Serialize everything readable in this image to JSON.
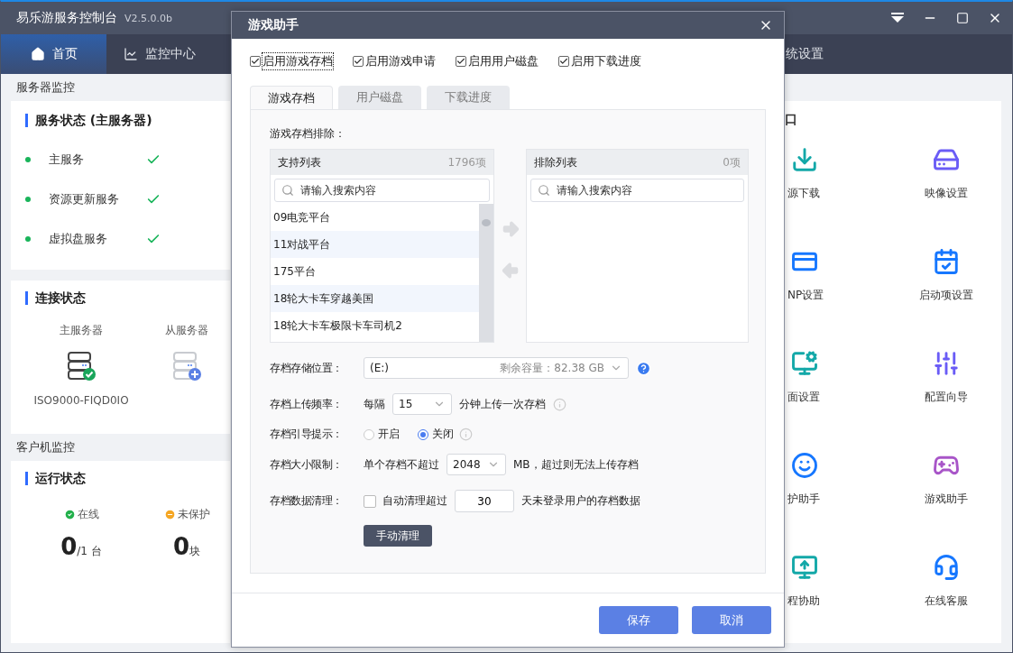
{
  "app": {
    "title": "易乐游服务控制台",
    "version": "V2.5.0.0b"
  },
  "nav": [
    {
      "label": "首页",
      "selected": true
    },
    {
      "label": "监控中心",
      "selected": false
    },
    {
      "label": "统设置",
      "selected": false
    }
  ],
  "server_monitor": {
    "heading": "服务器监控",
    "service_status": {
      "title": "服务状态 (主服务器)",
      "services": [
        {
          "name": "主服务",
          "ok": true
        },
        {
          "name": "资源更新服务",
          "ok": true
        },
        {
          "name": "虚拟盘服务",
          "ok": true
        }
      ]
    },
    "connection": {
      "title": "连接状态",
      "servers": [
        {
          "label": "主服务器",
          "name": "ISO9000-FIQD0IO",
          "connected": true
        },
        {
          "label": "从服务器",
          "connected": false
        }
      ]
    }
  },
  "client_monitor": {
    "heading": "客户机监控",
    "title": "运行状态",
    "stats": [
      {
        "kind": "online",
        "label": "在线",
        "value": "0",
        "unit": "/1 台"
      },
      {
        "kind": "unprotected",
        "label": "未保护",
        "value": "0",
        "unit": "块"
      }
    ]
  },
  "entries": {
    "title": "口",
    "items": [
      {
        "label": "源下载"
      },
      {
        "label": "映像设置"
      },
      {
        "label": "NP设置"
      },
      {
        "label": "启动项设置"
      },
      {
        "label": "面设置"
      },
      {
        "label": "配置向导"
      },
      {
        "label": "护助手"
      },
      {
        "label": "游戏助手"
      },
      {
        "label": "程协助"
      },
      {
        "label": "在线客服"
      }
    ]
  },
  "dialog": {
    "title": "游戏助手",
    "options": [
      {
        "label": "启用游戏存档",
        "checked": true,
        "focused": true
      },
      {
        "label": "启用游戏申请",
        "checked": true,
        "focused": false
      },
      {
        "label": "启用用户磁盘",
        "checked": true,
        "focused": false
      },
      {
        "label": "启用下载进度",
        "checked": true,
        "focused": false
      }
    ],
    "tabs": [
      {
        "label": "游戏存档",
        "selected": true
      },
      {
        "label": "用户磁盘",
        "selected": false
      },
      {
        "label": "下载进度",
        "selected": false
      }
    ],
    "transfer": {
      "label": "游戏存档排除：",
      "source": {
        "title": "支持列表",
        "count": "1796项",
        "placeholder": "请输入搜索内容",
        "items": [
          "09电竞平台",
          "11对战平台",
          "175平台",
          "18轮大卡车穿越美国",
          "18轮大卡车极限卡车司机2"
        ]
      },
      "target": {
        "title": "排除列表",
        "count": "0项",
        "placeholder": "请输入搜索内容"
      }
    },
    "storage": {
      "label": "存档存储位置：",
      "value": "(E:)",
      "free": "剩余容量：82.38 GB"
    },
    "frequency": {
      "label": "存档上传频率：",
      "prefix": "每隔",
      "value": "15",
      "suffix": "分钟上传一次存档"
    },
    "guide": {
      "label": "存档引导提示：",
      "options": [
        {
          "label": "开启",
          "selected": false
        },
        {
          "label": "关闭",
          "selected": true
        }
      ]
    },
    "size_limit": {
      "label": "存档大小限制：",
      "prefix": "单个存档不超过",
      "value": "2048",
      "suffix": "MB，超过则无法上传存档"
    },
    "cleanup": {
      "label": "存档数据清理：",
      "checkbox": {
        "label": "自动清理超过",
        "checked": false
      },
      "value": "30",
      "suffix": "天未登录用户的存档数据",
      "button": "手动清理"
    },
    "buttons": [
      "保存",
      "取消"
    ]
  }
}
